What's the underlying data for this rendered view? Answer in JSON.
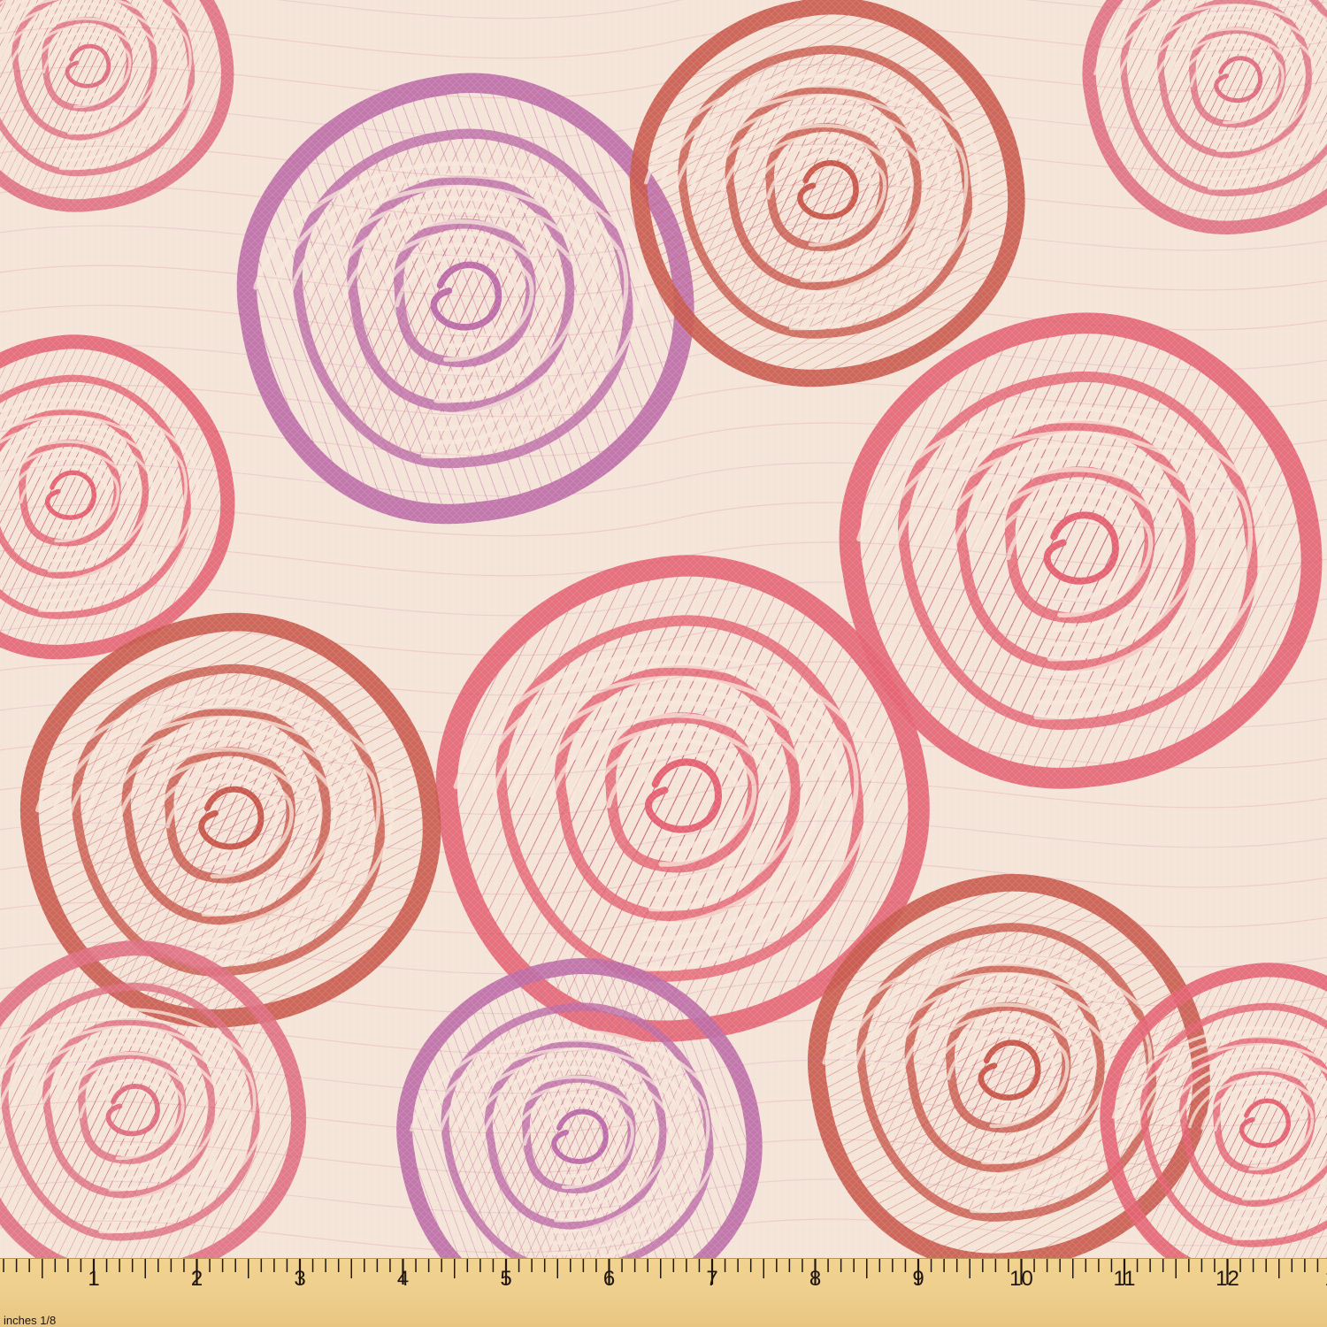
{
  "product_image": {
    "description_alt": "",
    "palette": {
      "background": "#f5e4d8",
      "coral": "#e56474",
      "rose": "#df6f82",
      "mauve": "#bd6da8",
      "terracotta": "#c95a4d",
      "hatch": "#c65f73",
      "cream": "#f8e8dc",
      "ruler": "#efcf8d",
      "ruler_marks": "#201710"
    },
    "ruler": {
      "unit_label": "inches 1/8",
      "numbers": [
        "1",
        "2",
        "3",
        "4",
        "5",
        "6",
        "7",
        "8",
        "9",
        "10",
        "11",
        "12",
        "1"
      ]
    }
  }
}
